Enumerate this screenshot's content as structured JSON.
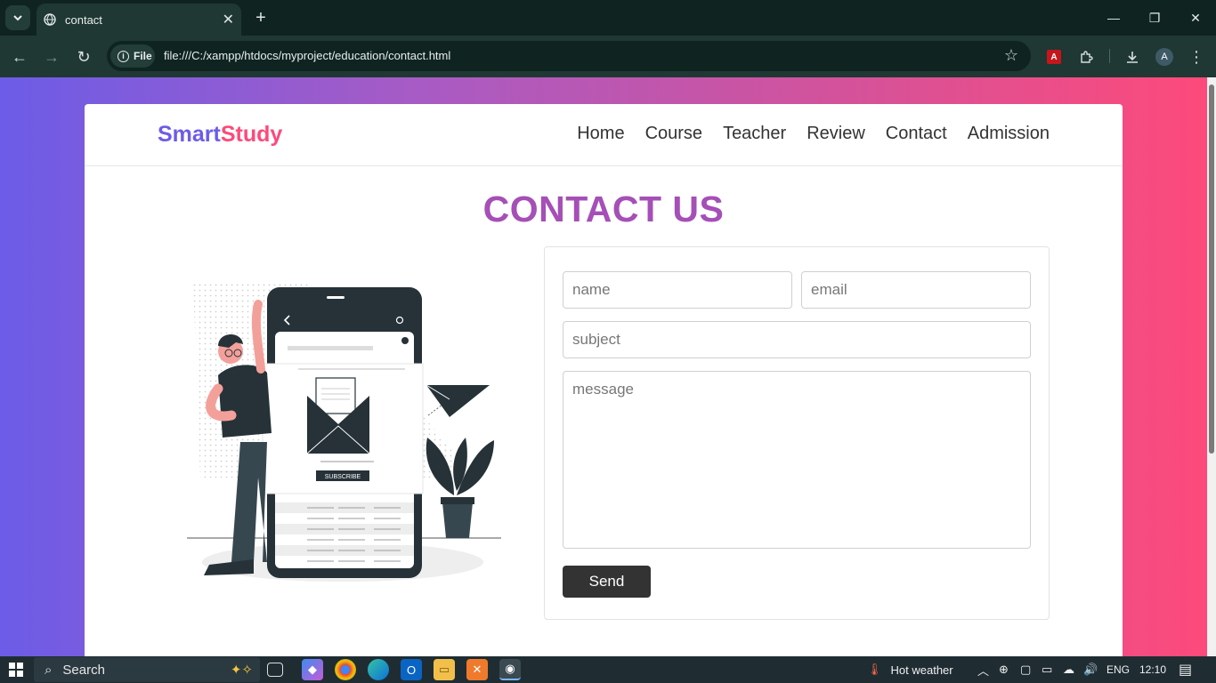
{
  "browser": {
    "tab_title": "contact",
    "url_scheme_label": "File",
    "url": "file:///C:/xampp/htdocs/myproject/education/contact.html",
    "profile_initial": "A"
  },
  "site": {
    "logo_part1": "Smart",
    "logo_part2": "Study",
    "nav": [
      "Home",
      "Course",
      "Teacher",
      "Review",
      "Contact",
      "Admission"
    ],
    "page_title": "CONTACT US",
    "illustration_button": "SUBSCRIBE"
  },
  "form": {
    "name_placeholder": "name",
    "email_placeholder": "email",
    "subject_placeholder": "subject",
    "message_placeholder": "message",
    "send_label": "Send"
  },
  "taskbar": {
    "search_label": "Search",
    "weather": "Hot weather",
    "language": "ENG",
    "time": "12:10"
  },
  "colors": {
    "gradient_start": "#6c5ce7",
    "gradient_end": "#fd4a7b",
    "title": "#a54fb7",
    "button": "#333333"
  }
}
